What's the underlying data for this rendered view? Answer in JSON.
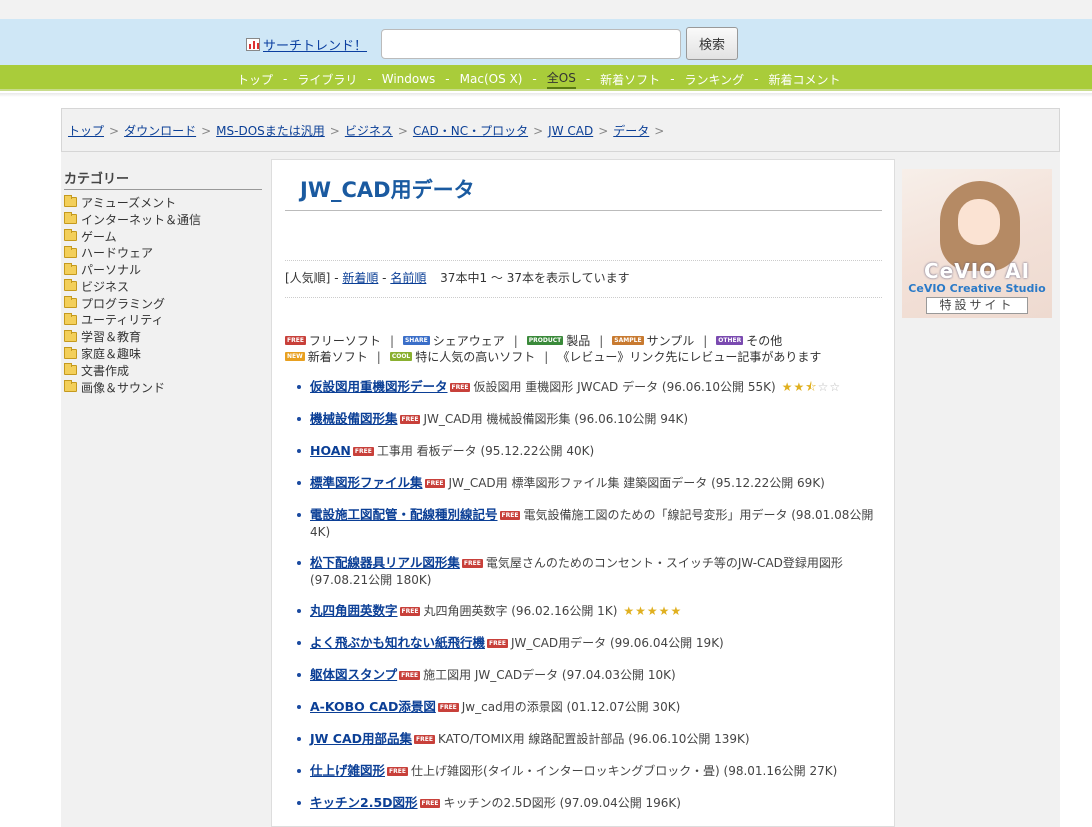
{
  "search": {
    "trend_label": "サーチトレンド！",
    "placeholder": "",
    "button": "検索"
  },
  "nav": {
    "items": [
      {
        "label": "トップ"
      },
      {
        "label": "ライブラリ"
      },
      {
        "label": "Windows"
      },
      {
        "label": "Mac(OS X)"
      },
      {
        "label": "全OS"
      },
      {
        "label": "新着ソフト"
      },
      {
        "label": "ランキング"
      },
      {
        "label": "新着コメント"
      }
    ],
    "separator": "-",
    "active": "全OS"
  },
  "breadcrumb": [
    {
      "label": "トップ"
    },
    {
      "label": "ダウンロード"
    },
    {
      "label": "MS-DOSまたは汎用"
    },
    {
      "label": "ビジネス"
    },
    {
      "label": "CAD・NC・プロッタ"
    },
    {
      "label": "JW CAD"
    },
    {
      "label": "データ"
    }
  ],
  "sidebar": {
    "title": "カテゴリー",
    "items": [
      {
        "label": "アミューズメント"
      },
      {
        "label": "インターネット＆通信"
      },
      {
        "label": "ゲーム"
      },
      {
        "label": "ハードウェア"
      },
      {
        "label": "パーソナル"
      },
      {
        "label": "ビジネス"
      },
      {
        "label": "プログラミング"
      },
      {
        "label": "ユーティリティ"
      },
      {
        "label": "学習＆教育"
      },
      {
        "label": "家庭＆趣味"
      },
      {
        "label": "文書作成"
      },
      {
        "label": "画像＆サウンド"
      }
    ]
  },
  "main": {
    "title": "JW_CAD用データ",
    "sort": {
      "popular": "[人気順]",
      "sep": " - ",
      "newest": "新着順",
      "name": "名前順",
      "count": "37本中1 〜 37本を表示しています"
    },
    "legend": {
      "free": "フリーソフト",
      "shareware": "シェアウェア",
      "product": "製品",
      "sample": "サンプル",
      "other": "その他",
      "new": "新着ソフト",
      "popular": "特に人気の高いソフト",
      "review": "《レビュー》リンク先にレビュー記事があります",
      "sep": "|",
      "badge_free": "FREE",
      "badge_share": "SHARE",
      "badge_product": "PRODUCT",
      "badge_sample": "SAMPLE",
      "badge_other": "OTHER",
      "badge_new": "NEW",
      "badge_cool": "COOL"
    },
    "items": [
      {
        "title": "仮設図用重機図形データ",
        "badge": "FREE",
        "desc": "仮設図用 重機図形 JWCAD データ (96.06.10公開 55K)",
        "rating": 2.5
      },
      {
        "title": "機械設備図形集",
        "badge": "FREE",
        "desc": "JW_CAD用 機械設備図形集 (96.06.10公開 94K)"
      },
      {
        "title": "HOAN",
        "badge": "FREE",
        "desc": "工事用 看板データ (95.12.22公開 40K)"
      },
      {
        "title": "標準図形ファイル集",
        "badge": "FREE",
        "desc": "JW_CAD用 標準図形ファイル集 建築図面データ (95.12.22公開 69K)"
      },
      {
        "title": "電設施工図配管・配線種別線記号",
        "badge": "FREE",
        "desc": "電気設備施工図のための「線記号変形」用データ (98.01.08公開 4K)"
      },
      {
        "title": "松下配線器具リアル図形集",
        "badge": "FREE",
        "desc": "電気屋さんのためのコンセント・スイッチ等のJW-CAD登録用図形 (97.08.21公開 180K)"
      },
      {
        "title": "丸四角囲英数字",
        "badge": "FREE",
        "desc": "丸四角囲英数字 (96.02.16公開 1K)",
        "rating": 5
      },
      {
        "title": "よく飛ぶかも知れない紙飛行機",
        "badge": "FREE",
        "desc": "JW_CAD用データ (99.06.04公開 19K)"
      },
      {
        "title": "躯体図スタンプ",
        "badge": "FREE",
        "desc": "施工図用 JW_CADデータ (97.04.03公開 10K)"
      },
      {
        "title": "A-KOBO CAD添景図",
        "badge": "FREE",
        "desc": "Jw_cad用の添景図 (01.12.07公開 30K)"
      },
      {
        "title": "JW CAD用部品集",
        "badge": "FREE",
        "desc": "KATO/TOMIX用 線路配置設計部品 (96.06.10公開 139K)"
      },
      {
        "title": "仕上げ雑図形",
        "badge": "FREE",
        "desc": "仕上げ雑図形(タイル・インターロッキングブロック・畳) (98.01.16公開 27K)"
      },
      {
        "title": "キッチン2.5D図形",
        "badge": "FREE",
        "desc": "キッチンの2.5D図形 (97.09.04公開 196K)"
      }
    ]
  },
  "ad": {
    "brand": "CeVIO AI",
    "studio": "CeVIO Creative Studio",
    "site": "特設サイト"
  },
  "colors": {
    "nav_green": "#a9cc3a",
    "search_blue": "#cfe7f6",
    "title_blue": "#1a5aa0",
    "link": "#0b3f96"
  }
}
